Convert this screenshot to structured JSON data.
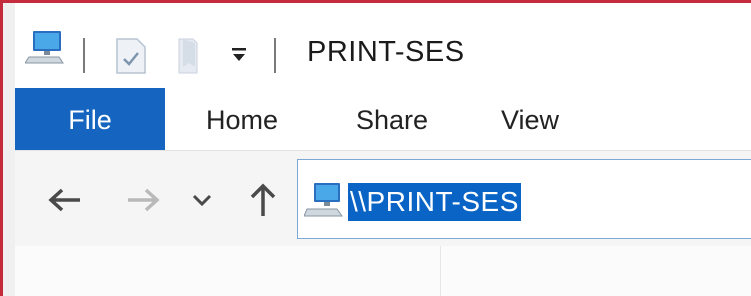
{
  "window": {
    "title": "PRINT-SES",
    "accent_color": "#c42b3c"
  },
  "quick_access": {
    "icons": [
      "computer-icon",
      "properties-icon",
      "new-folder-icon",
      "customize-dropdown-icon"
    ]
  },
  "ribbon": {
    "tabs": [
      {
        "label": "File",
        "active": true
      },
      {
        "label": "Home"
      },
      {
        "label": "Share"
      },
      {
        "label": "View"
      }
    ],
    "file_color": "#1565c0"
  },
  "navigation": {
    "buttons": [
      "back-arrow-icon",
      "forward-arrow-icon",
      "recent-locations-chevron-icon",
      "up-arrow-icon"
    ],
    "address_value": "\\\\PRINT-SES",
    "selection_color": "#0a64c6"
  }
}
